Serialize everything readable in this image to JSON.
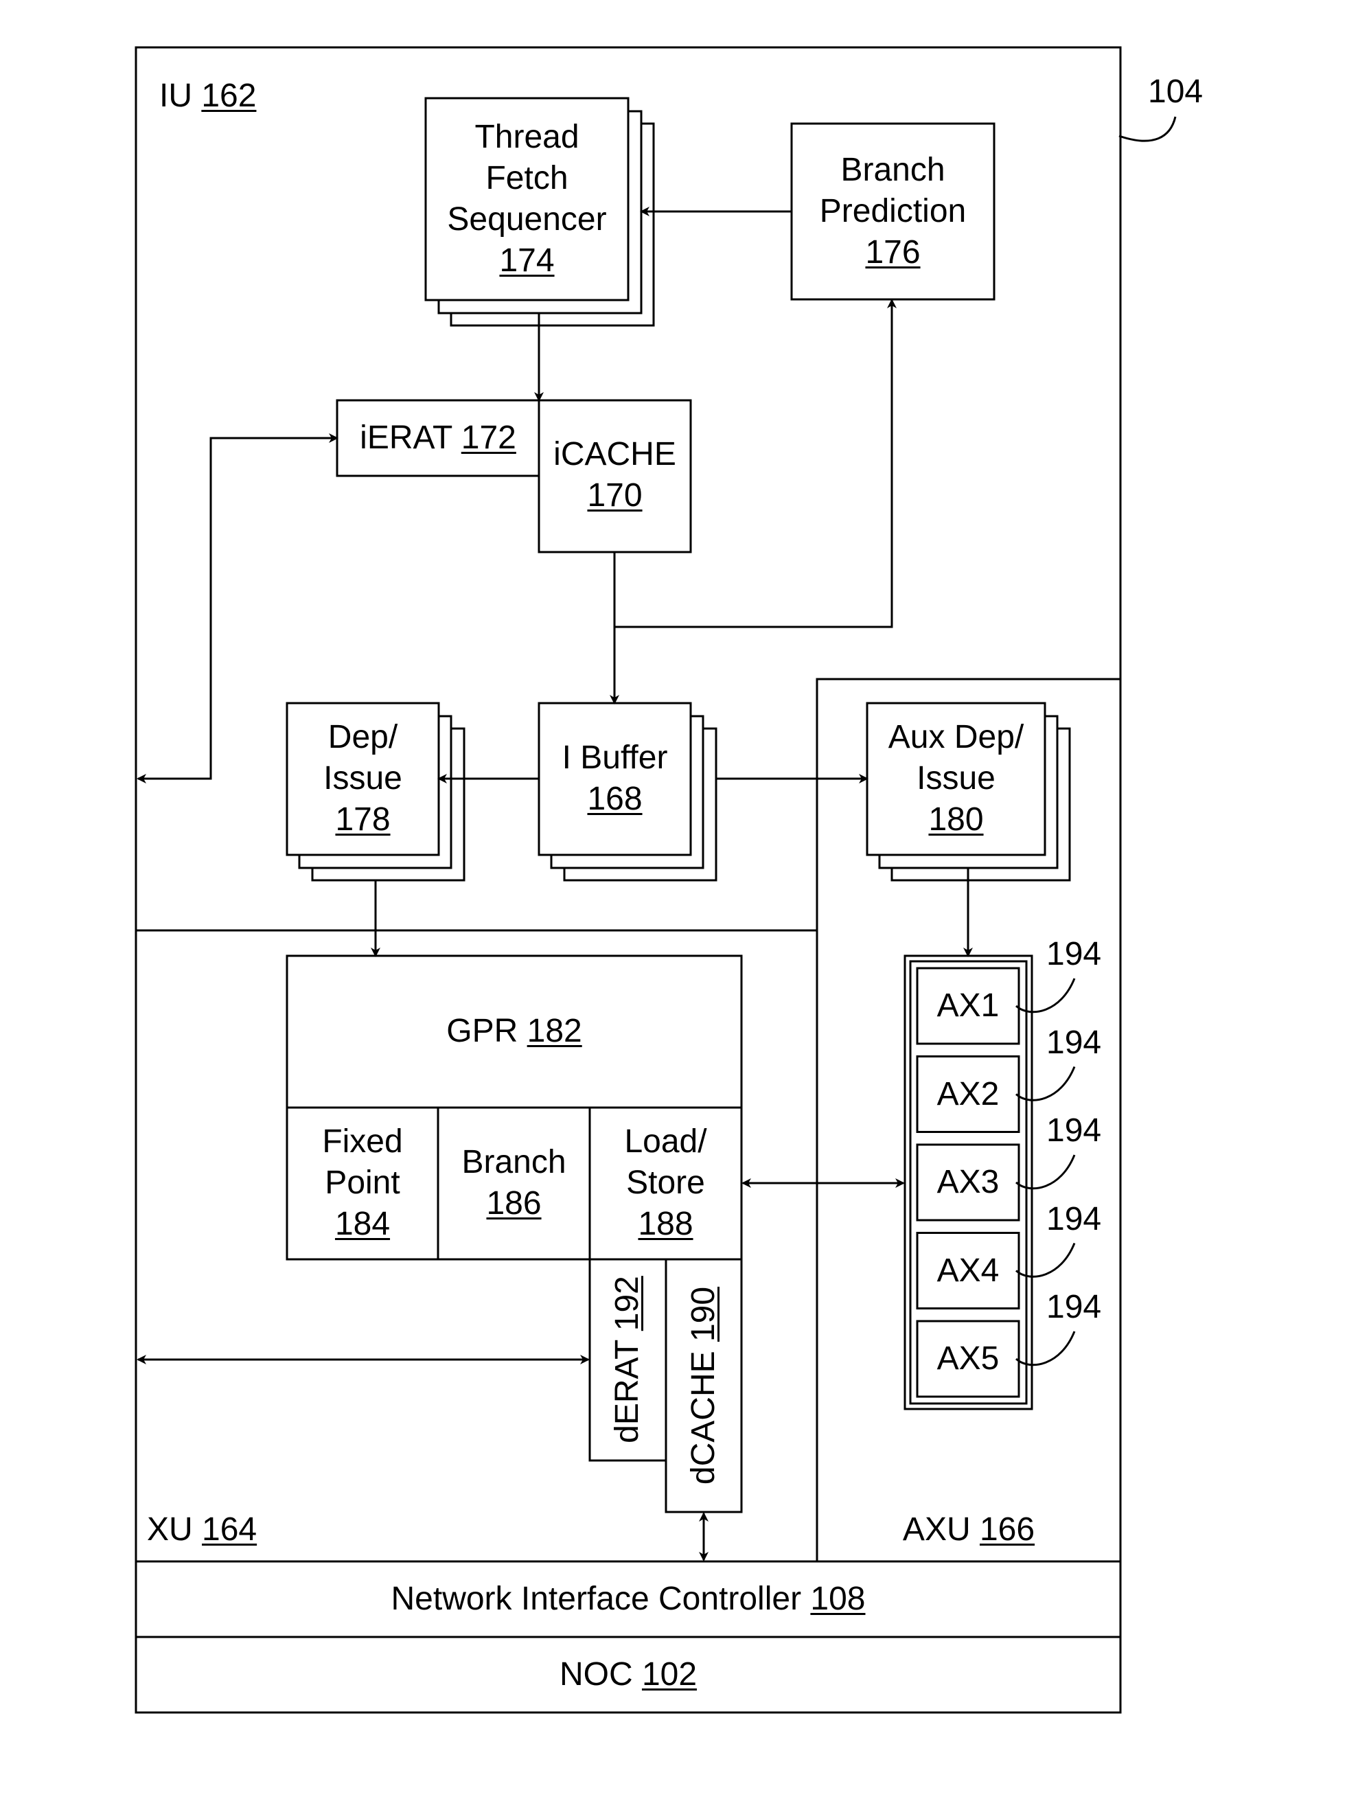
{
  "figure": {
    "ref": "104",
    "units": {
      "iu": {
        "name": "IU",
        "num": "162"
      },
      "xu": {
        "name": "XU",
        "num": "164"
      },
      "axu": {
        "name": "AXU",
        "num": "166"
      }
    },
    "blocks": {
      "tfs": {
        "lines": [
          "Thread",
          "Fetch",
          "Sequencer"
        ],
        "num": "174"
      },
      "bp": {
        "lines": [
          "Branch",
          "Prediction"
        ],
        "num": "176"
      },
      "ierat": {
        "name": "iERAT",
        "num": "172"
      },
      "icache": {
        "name": "iCACHE",
        "num": "170"
      },
      "dep": {
        "lines": [
          "Dep/",
          "Issue"
        ],
        "num": "178"
      },
      "ibuf": {
        "name": "I Buffer",
        "num": "168"
      },
      "auxdep": {
        "lines": [
          "Aux Dep/",
          "Issue"
        ],
        "num": "180"
      },
      "gpr": {
        "name": "GPR",
        "num": "182"
      },
      "fixed": {
        "lines": [
          "Fixed",
          "Point"
        ],
        "num": "184"
      },
      "branch": {
        "name": "Branch",
        "num": "186"
      },
      "ls": {
        "lines": [
          "Load/",
          "Store"
        ],
        "num": "188"
      },
      "derat": {
        "name": "dERAT",
        "num": "192"
      },
      "dcache": {
        "name": "dCACHE",
        "num": "190"
      },
      "nic": {
        "name": "Network Interface Controller",
        "num": "108"
      },
      "noc": {
        "name": "NOC",
        "num": "102"
      }
    },
    "ax_units": [
      {
        "name": "AX1",
        "ref": "194"
      },
      {
        "name": "AX2",
        "ref": "194"
      },
      {
        "name": "AX3",
        "ref": "194"
      },
      {
        "name": "AX4",
        "ref": "194"
      },
      {
        "name": "AX5",
        "ref": "194"
      }
    ]
  }
}
